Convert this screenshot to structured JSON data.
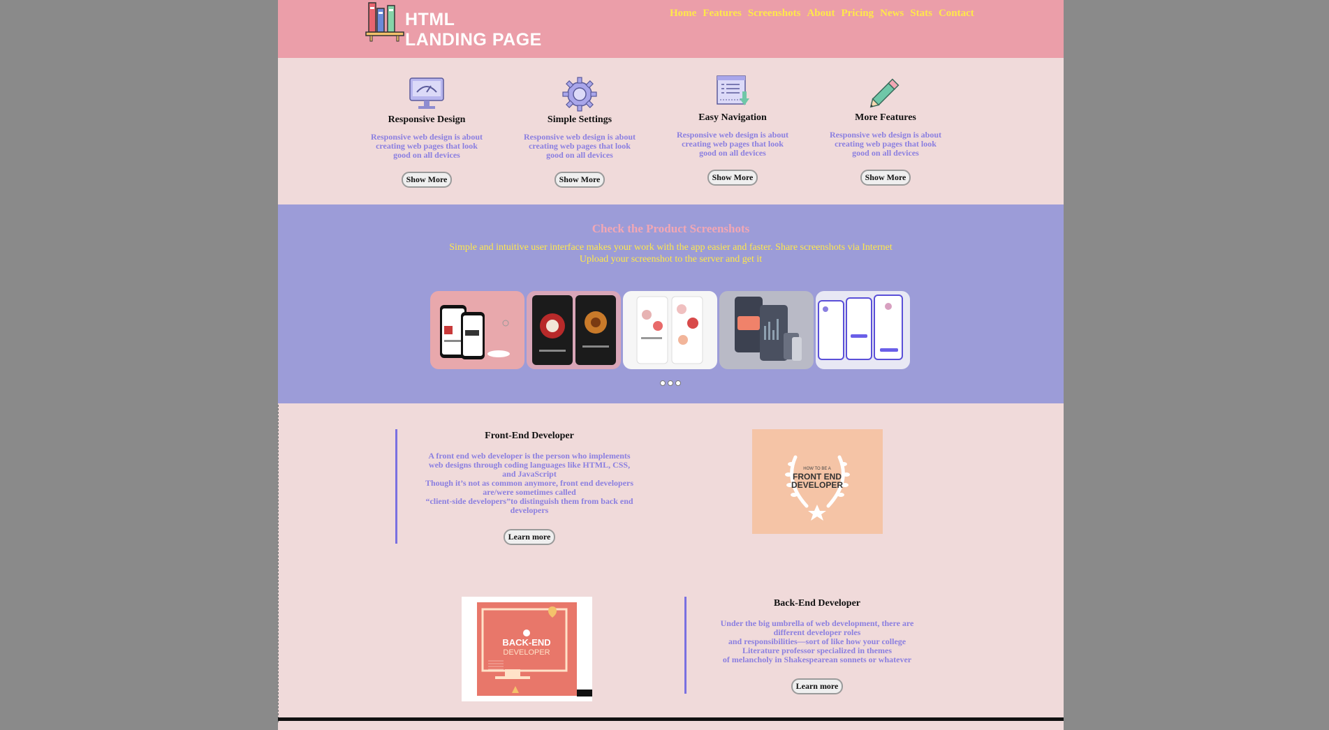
{
  "header": {
    "logo_line1": "HTML",
    "logo_line2": "LANDING PAGE",
    "nav": [
      "Home",
      "Features",
      "Screenshots",
      "About",
      "Pricing",
      "News",
      "Stats",
      "Contact"
    ]
  },
  "features": [
    {
      "icon": "monitor-icon",
      "title": "Responsive Design",
      "text": "Responsive web design is about creating web pages that look good on all devices",
      "button": "Show More"
    },
    {
      "icon": "gear-icon",
      "title": "Simple Settings",
      "text": "Responsive web design is about creating web pages that look good on all devices",
      "button": "Show More"
    },
    {
      "icon": "document-download-icon",
      "title": "Easy Navigation",
      "text": "Responsive web design is about creating web pages that look good on all devices",
      "button": "Show More"
    },
    {
      "icon": "pencil-icon",
      "title": "More Features",
      "text": "Responsive web design is about creating web pages that look good on all devices",
      "button": "Show More"
    }
  ],
  "screenshots": {
    "title": "Check the Product Screenshots",
    "line1": "Simple and intuitive user interface makes your work with the app easier and faster. Share screenshots via Internet",
    "line2": "Upload your screenshot to the server and get it"
  },
  "frontend": {
    "title": "Front-End Developer",
    "text1": "A front end web developer is the person who implements web designs through coding languages like HTML, CSS, and JavaScript",
    "text2": "Though it’s not as common anymore, front end developers are/were sometimes called",
    "text3": "“client-side developers”to distinguish them from back end developers",
    "button": "Learn more",
    "image_caption_small": "HOW TO BE A",
    "image_caption_line1": "FRONT END",
    "image_caption_line2": "DEVELOPER"
  },
  "backend": {
    "title": "Back-End Developer",
    "text1": "Under the big umbrella of web development, there are different developer roles",
    "text2": "and responsibilities—sort of like how your college",
    "text3": "Literature professor specialized in themes",
    "text4": "of melancholy in Shakespearean sonnets or whatever",
    "button": "Learn more",
    "image_caption_line1": "BACK-END",
    "image_caption_line2": "DEVELOPER"
  },
  "colors": {
    "header_bg": "#eb9ea9",
    "nav_link": "#ffe84a",
    "body_bg": "#f0dada",
    "screenshots_bg": "#9c9cd8",
    "accent_text": "#8b7fe0"
  }
}
